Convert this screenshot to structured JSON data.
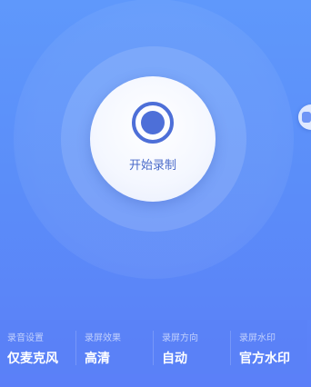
{
  "record": {
    "label": "开始录制"
  },
  "settings": [
    {
      "title": "录音设置",
      "value": "仅麦克风"
    },
    {
      "title": "录屏效果",
      "value": "高清"
    },
    {
      "title": "录屏方向",
      "value": "自动"
    },
    {
      "title": "录屏水印",
      "value": "官方水印"
    }
  ],
  "colors": {
    "background_top": "#5f98fb",
    "background_bottom": "#5b7ff8",
    "accent": "#4b6bc9"
  }
}
